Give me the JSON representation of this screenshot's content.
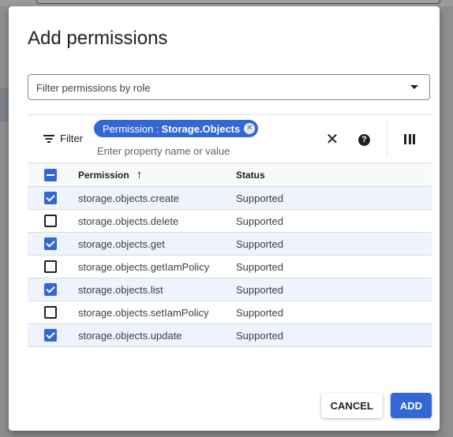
{
  "dialog": {
    "title": "Add permissions",
    "role_filter": {
      "placeholder": "Filter permissions by role"
    },
    "filter_bar": {
      "filter_label": "Filter",
      "chip": {
        "key": "Permission :",
        "value": "Storage.Objects"
      },
      "input_placeholder": "Enter property name or value",
      "icons": [
        "filter-icon",
        "close-icon",
        "help-icon",
        "columns-icon"
      ]
    },
    "table": {
      "headers": {
        "permission": "Permission",
        "status": "Status",
        "sort_direction": "ascending"
      },
      "select_all_state": "indeterminate",
      "rows": [
        {
          "permission": "storage.objects.create",
          "status": "Supported",
          "checked": true
        },
        {
          "permission": "storage.objects.delete",
          "status": "Supported",
          "checked": false
        },
        {
          "permission": "storage.objects.get",
          "status": "Supported",
          "checked": true
        },
        {
          "permission": "storage.objects.getIamPolicy",
          "status": "Supported",
          "checked": false
        },
        {
          "permission": "storage.objects.list",
          "status": "Supported",
          "checked": true
        },
        {
          "permission": "storage.objects.setIamPolicy",
          "status": "Supported",
          "checked": false
        },
        {
          "permission": "storage.objects.update",
          "status": "Supported",
          "checked": true
        }
      ]
    },
    "buttons": {
      "cancel": "CANCEL",
      "add": "ADD"
    }
  },
  "colors": {
    "accent": "#3367d6",
    "selected_row": "#eef3fd"
  }
}
